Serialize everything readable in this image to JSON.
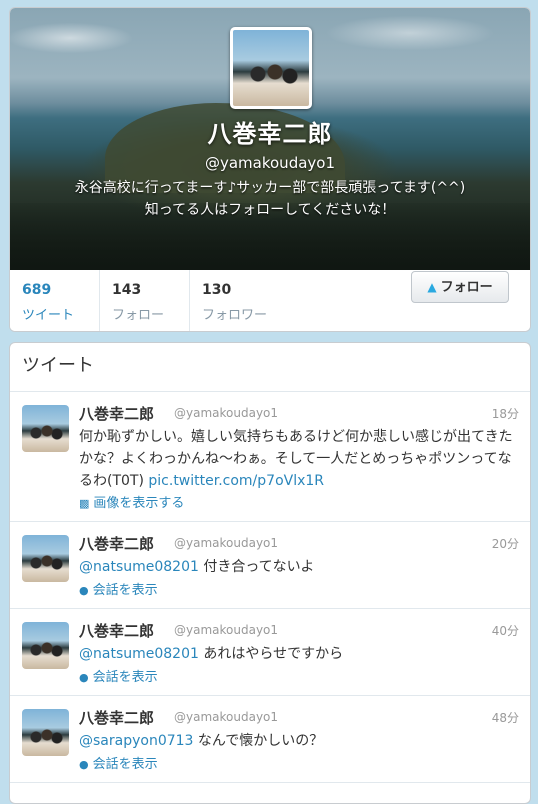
{
  "profile": {
    "name": "八巻幸二郎",
    "handle": "@yamakoudayo1",
    "bio_line1": "永谷高校に行ってまーす♪サッカー部で部長頑張ってます(^^)",
    "bio_line2": "知ってる人はフォローしてくださいな！",
    "stats": [
      {
        "count": "689",
        "label": "ツイート"
      },
      {
        "count": "143",
        "label": "フォロー"
      },
      {
        "count": "130",
        "label": "フォロワー"
      }
    ],
    "follow_label": "フォロー",
    "follow_icon": "twitter-bird-icon"
  },
  "tweets_header": "ツイート",
  "tweets": [
    {
      "name": "八巻幸二郎",
      "handle": "@yamakoudayo1",
      "time": "18分",
      "mention": "",
      "text": "何か恥ずかしい。嬉しい気持ちもあるけど何か悲しい感じが出てきたかな？よくわっかんね〜わぁ。そして一人だとめっちゃポツンってなるわ(T0T)",
      "link": "pic.twitter.com/p7oVlx1R",
      "action": "画像を表示する",
      "action_icon": "image-icon"
    },
    {
      "name": "八巻幸二郎",
      "handle": "@yamakoudayo1",
      "time": "20分",
      "mention": "@natsume08201",
      "text": "付き合ってないよ",
      "link": "",
      "action": "会話を表示",
      "action_icon": "conversation-icon"
    },
    {
      "name": "八巻幸二郎",
      "handle": "@yamakoudayo1",
      "time": "40分",
      "mention": "@natsume08201",
      "text": "あれはやらせですから",
      "link": "",
      "action": "会話を表示",
      "action_icon": "conversation-icon"
    },
    {
      "name": "八巻幸二郎",
      "handle": "@yamakoudayo1",
      "time": "48分",
      "mention": "@sarapyon0713",
      "text": "なんで懐かしいの？",
      "link": "",
      "action": "会話を表示",
      "action_icon": "conversation-icon"
    }
  ]
}
